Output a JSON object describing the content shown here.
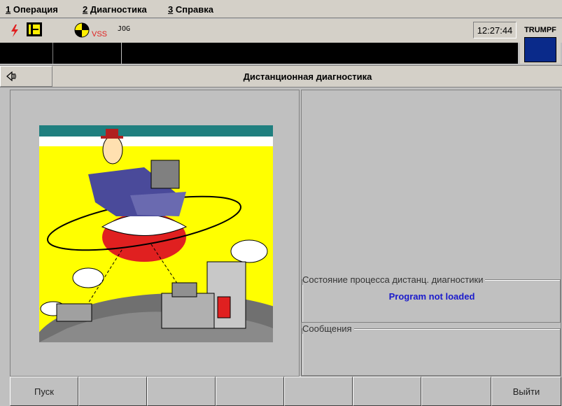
{
  "menu": {
    "items": [
      {
        "acc": "1",
        "label": " Операция"
      },
      {
        "acc": "2",
        "label": " Диагностика"
      },
      {
        "acc": "3",
        "label": " Справка"
      }
    ]
  },
  "status": {
    "vss": "VSS",
    "mode": "JOG",
    "time": "12:27:44",
    "brand": "TRUMPF"
  },
  "header": {
    "title": "Дистанционная диагностика"
  },
  "right": {
    "state_label": "Состояние процесса дистанц. диагностики",
    "state_value": "Program not loaded",
    "messages_label": "Сообщения"
  },
  "fkeys": [
    "Пуск",
    "",
    "",
    "",
    "",
    "",
    "",
    "Выйти"
  ],
  "colors": {
    "accent_blue": "#1a1acc",
    "brand_blue": "#0a2a8a",
    "alarm_red": "#e02020"
  }
}
